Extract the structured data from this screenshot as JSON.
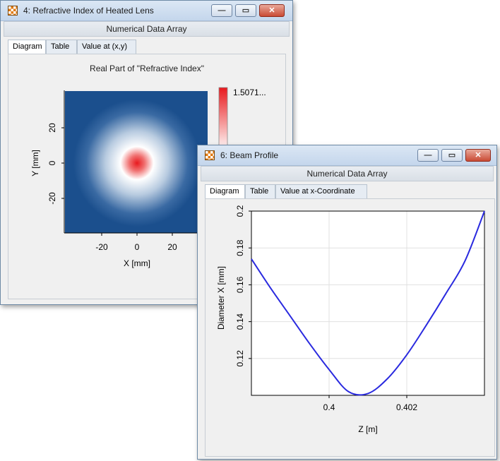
{
  "window1": {
    "title": "4: Refractive Index of Heated Lens",
    "subheader": "Numerical Data Array",
    "tabs": [
      "Diagram",
      "Table",
      "Value at (x,y)"
    ],
    "active_tab": "Diagram",
    "chart_title": "Real Part of \"Refractive Index\"",
    "colorbar_max_label": "1.5071...",
    "x_label": "X [mm]",
    "y_label": "Y [mm]",
    "x_ticks": [
      "-20",
      "0",
      "20"
    ],
    "y_ticks": [
      "20",
      "0",
      "-20"
    ]
  },
  "window2": {
    "title": "6: Beam Profile",
    "subheader": "Numerical Data Array",
    "tabs": [
      "Diagram",
      "Table",
      "Value at x-Coordinate"
    ],
    "active_tab": "Diagram",
    "x_label": "Z [m]",
    "y_label": "Diameter X [mm]",
    "x_ticks": [
      "0.4",
      "0.402"
    ],
    "y_ticks": [
      "0.2",
      "0.18",
      "0.16",
      "0.14",
      "0.12"
    ]
  },
  "controls": {
    "minimize": "—",
    "maximize": "▭",
    "close": "✕"
  },
  "colors": {
    "heatmap_background": "#1b4f8d",
    "heatmap_peak": "#e8191e",
    "curve": "#2a2adf"
  },
  "chart_data": [
    {
      "type": "heatmap",
      "title": "Real Part of \"Refractive Index\"",
      "xlabel": "X [mm]",
      "ylabel": "Y [mm]",
      "xlim": [
        -40,
        40
      ],
      "ylim": [
        -40,
        40
      ],
      "peak_center": [
        0,
        0
      ],
      "colorbar_max": "1.5071..."
    },
    {
      "type": "line",
      "xlabel": "Z [m]",
      "ylabel": "Diameter X [mm]",
      "xlim": [
        0.398,
        0.404
      ],
      "ylim": [
        0.1,
        0.2
      ],
      "grid": true,
      "series": [
        {
          "x": [
            0.398,
            0.3985,
            0.399,
            0.3995,
            0.4,
            0.4005,
            0.401,
            0.4015,
            0.402,
            0.4025,
            0.403,
            0.4035,
            0.404
          ],
          "values": [
            0.174,
            0.158,
            0.143,
            0.128,
            0.114,
            0.102,
            0.101,
            0.109,
            0.122,
            0.138,
            0.155,
            0.173,
            0.2
          ]
        }
      ]
    }
  ]
}
